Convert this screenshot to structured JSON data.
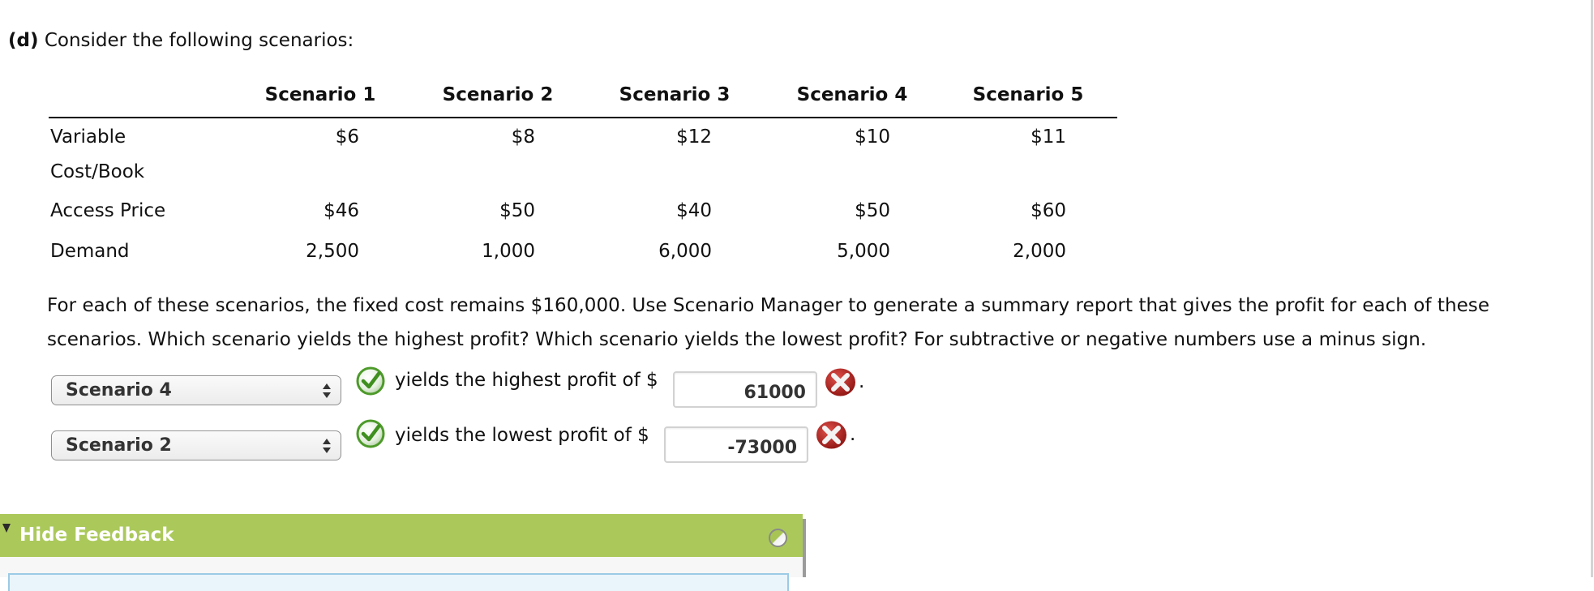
{
  "heading": {
    "part_label": "(d)",
    "text": "Consider the following scenarios:"
  },
  "table": {
    "columns": [
      "Scenario 1",
      "Scenario 2",
      "Scenario 3",
      "Scenario 4",
      "Scenario 5"
    ],
    "rows": [
      {
        "label_line1": "Variable",
        "label_line2": "Cost/Book",
        "values": [
          "$6",
          "$8",
          "$12",
          "$10",
          "$11"
        ]
      },
      {
        "label": "Access Price",
        "values": [
          "$46",
          "$50",
          "$40",
          "$50",
          "$60"
        ]
      },
      {
        "label": "Demand",
        "values": [
          "2,500",
          "1,000",
          "6,000",
          "5,000",
          "2,000"
        ]
      }
    ]
  },
  "prompt": "For each of these scenarios, the fixed cost remains $160,000. Use Scenario Manager to generate a summary report that gives the profit for each of these scenarios. Which scenario yields the highest profit? Which scenario yields the lowest profit? For subtractive or negative numbers use a minus sign.",
  "answers": {
    "highest": {
      "selected_scenario": "Scenario 4",
      "scenario_status": "correct",
      "text": "yields the highest profit of $",
      "value": "61000",
      "value_status": "incorrect",
      "suffix": "."
    },
    "lowest": {
      "selected_scenario": "Scenario 2",
      "scenario_status": "correct",
      "text": "yields the lowest profit of $",
      "value": "-73000",
      "value_status": "incorrect",
      "suffix": "."
    }
  },
  "feedback": {
    "toggle_label": "Hide Feedback",
    "bar_color": "#abc95b"
  },
  "colors": {
    "correct": "#4d9a2a",
    "incorrect": "#b3211f"
  }
}
